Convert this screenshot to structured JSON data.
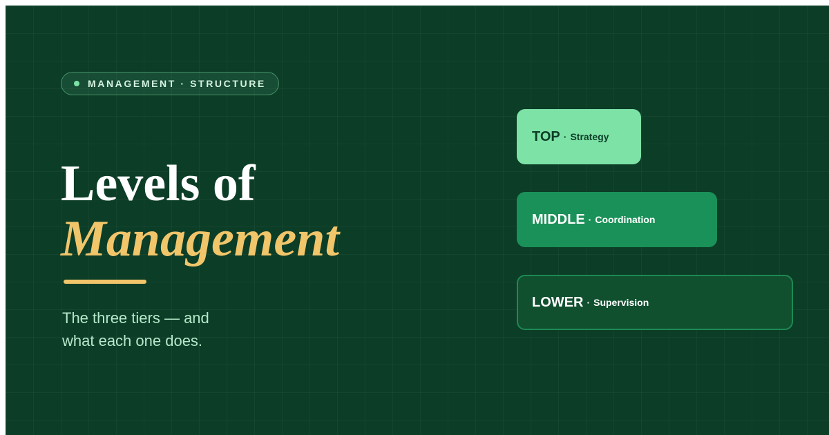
{
  "badge": {
    "text": "MANAGEMENT · STRUCTURE",
    "dot_icon": "dot-icon"
  },
  "title": {
    "line1": "Levels of",
    "line2": "Management"
  },
  "subtitle": {
    "line1": "The three tiers — and",
    "line2": "what each one does."
  },
  "tiers": [
    {
      "name": "TOP",
      "separator": "·",
      "description": "Strategy",
      "color": "#7de2a6"
    },
    {
      "name": "MIDDLE",
      "separator": "·",
      "description": "Coordination",
      "color": "#1a9158"
    },
    {
      "name": "LOWER",
      "separator": "·",
      "description": "Supervision",
      "color": "#10502f"
    }
  ],
  "colors": {
    "background": "#0c3d27",
    "accent": "#f1c56a",
    "badge_dot": "#7de2a6",
    "subtitle": "#b7e8cb"
  }
}
